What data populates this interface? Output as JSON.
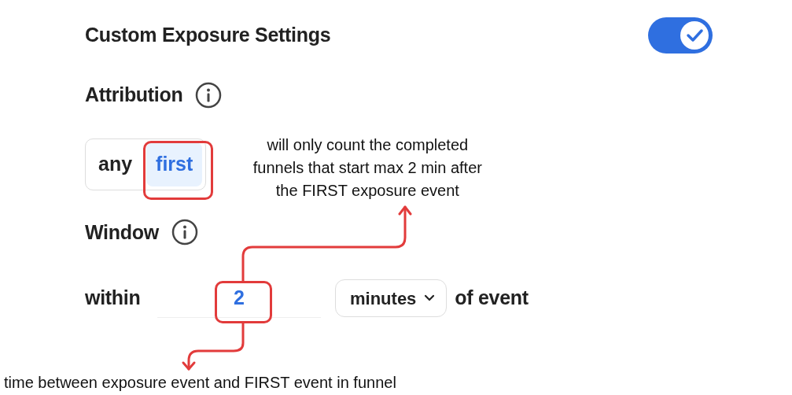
{
  "title": "Custom Exposure Settings",
  "exposure_toggle": {
    "on": true
  },
  "attribution": {
    "label": "Attribution",
    "options": [
      {
        "label": "any",
        "selected": false
      },
      {
        "label": "first",
        "selected": true
      }
    ]
  },
  "window": {
    "label": "Window",
    "prefix": "within",
    "value": "2",
    "unit": "minutes",
    "suffix": "of event"
  },
  "annotations": [
    {
      "lines": [
        "will only count the completed",
        "funnels that start max 2 min after",
        "the FIRST exposure event"
      ]
    },
    {
      "lines": [
        "time between exposure event and FIRST event in funnel"
      ]
    }
  ]
}
